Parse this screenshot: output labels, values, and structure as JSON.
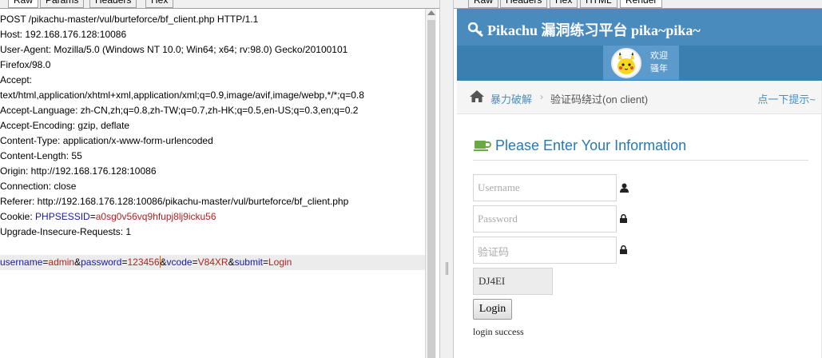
{
  "left_tabs": [
    "Raw",
    "Params",
    "Headers",
    "Hex"
  ],
  "right_tabs": [
    "Raw",
    "Headers",
    "Hex",
    "HTML",
    "Render"
  ],
  "request": {
    "lines": [
      "POST /pikachu-master/vul/burteforce/bf_client.php HTTP/1.1",
      "Host: 192.168.176.128:10086",
      "User-Agent: Mozilla/5.0 (Windows NT 10.0; Win64; x64; rv:98.0) Gecko/20100101",
      "Firefox/98.0",
      "Accept:",
      "text/html,application/xhtml+xml,application/xml;q=0.9,image/avif,image/webp,*/*;q=0.8",
      "Accept-Language: zh-CN,zh;q=0.8,zh-TW;q=0.7,zh-HK;q=0.5,en-US;q=0.3,en;q=0.2",
      "Accept-Encoding: gzip, deflate",
      "Content-Type: application/x-www-form-urlencoded",
      "Content-Length: 55",
      "Origin: http://192.168.176.128:10086",
      "Connection: close",
      "Referer: http://192.168.176.128:10086/pikachu-master/vul/burteforce/bf_client.php"
    ],
    "cookie_prefix": "Cookie: ",
    "cookie_name": "PHPSESSID",
    "cookie_eq": "=",
    "cookie_value": "a0sg0v56vq9hfupj8lj9icku56",
    "upgrade_line": "Upgrade-Insecure-Requests: 1",
    "body": {
      "k1": "username",
      "v1": "admin",
      "k2": "password",
      "v2": "123456",
      "k3": "vcode",
      "v3": "V84XR",
      "k4": "submit",
      "v4": "Login",
      "eq": "=",
      "amp": "&"
    }
  },
  "page": {
    "brand": "Pikachu 漏洞练习平台 pika~pika~",
    "greet_line1": "欢迎",
    "greet_line2": "骚年",
    "crumb_home": "暴力破解",
    "crumb_current": "验证码绕过(on client)",
    "hint": "点一下提示~",
    "form_title": "Please Enter Your Information",
    "username_placeholder": "Username",
    "password_placeholder": "Password",
    "vcode_placeholder": "验证码",
    "vcode_value": "DJ4EI",
    "login_label": "Login",
    "login_message": "login success"
  },
  "colors": {
    "navbar": "#3b7fb0",
    "link": "#4c8fbd",
    "title": "#2679b5",
    "param_key": "#1a1aa6",
    "param_value": "#b22222"
  }
}
